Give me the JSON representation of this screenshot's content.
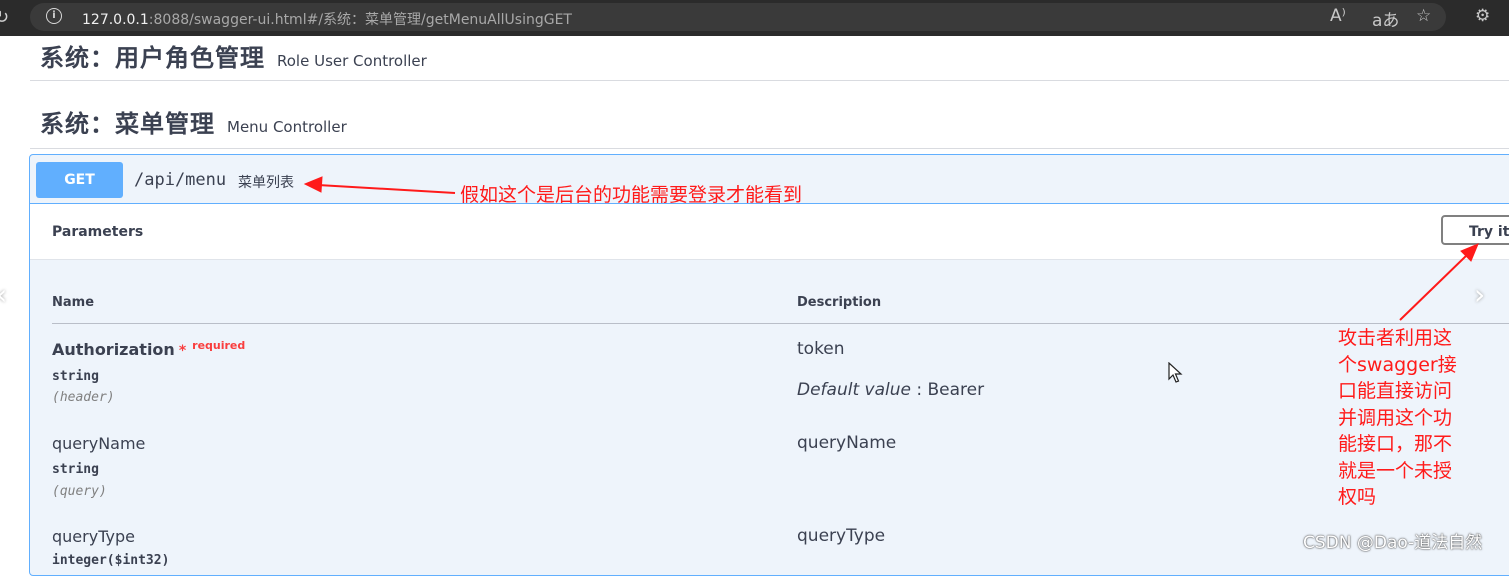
{
  "browser": {
    "url_host": "127.0.0.1",
    "url_rest": ":8088/swagger-ui.html#/系统：菜单管理/getMenuAllUsingGET",
    "icons": [
      "reload-icon",
      "info-icon",
      "read-aloud-icon",
      "translate-icon",
      "favorite-star-icon",
      "extensions-icon"
    ],
    "read_aloud_glyph": "A⁾",
    "translate_glyph": "aあ"
  },
  "tags": [
    {
      "title": "系统：用户角色管理",
      "desc": "Role User Controller"
    },
    {
      "title": "系统：菜单管理",
      "desc": "Menu Controller"
    }
  ],
  "operation": {
    "method": "GET",
    "path": "/api/menu",
    "summary": "菜单列表",
    "section_title": "Parameters",
    "try_button": "Try it out",
    "columns": {
      "name": "Name",
      "description": "Description"
    },
    "params": [
      {
        "name": "Authorization",
        "star": "*",
        "required_label": "required",
        "type": "string",
        "in": "(header)",
        "desc": "token",
        "default_label": "Default value",
        "default_sep": " : ",
        "default_value": "Bearer"
      },
      {
        "name": "queryName",
        "type": "string",
        "in": "(query)",
        "desc": "queryName"
      },
      {
        "name": "queryType",
        "type": "integer($int32)",
        "desc": "queryType"
      }
    ],
    "colors": {
      "accent": "#61affe",
      "background": "#eef4fb",
      "required": "#f93e3e"
    }
  },
  "annotations": {
    "note1": "假如这个是后台的功能需要登录才能看到",
    "note2": "攻击者利用这个swagger接口能直接访问并调用这个功能接口，那不就是一个未授权吗",
    "color": "#ff1a1a"
  },
  "watermark": "CSDN @Dao-道法自然"
}
